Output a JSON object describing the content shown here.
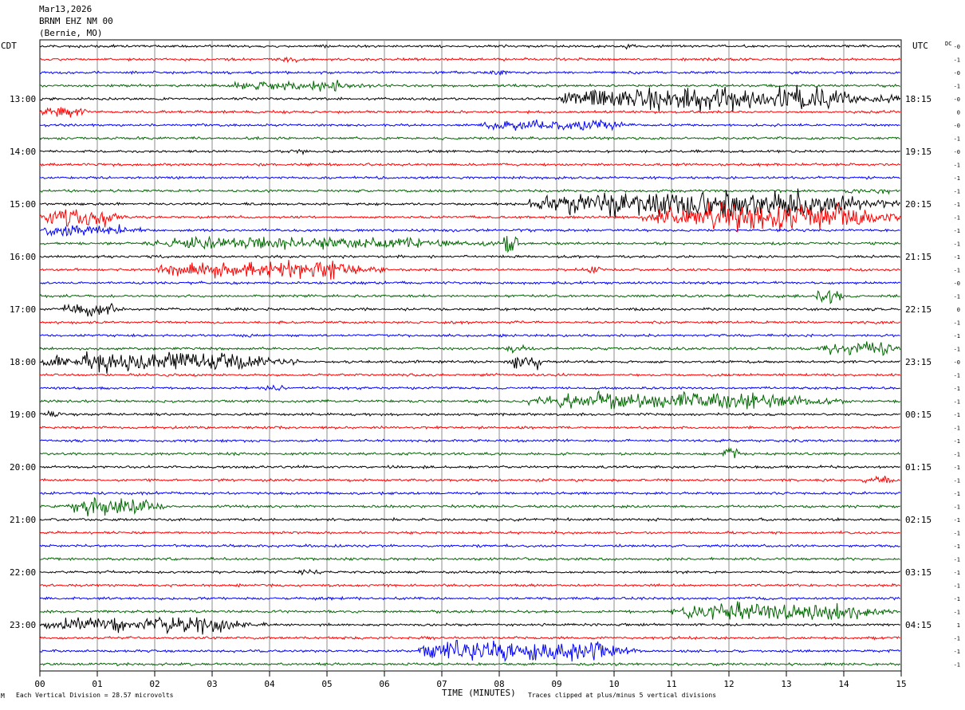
{
  "header": {
    "date": "Mar13,2026",
    "station": "BRNM EHZ NM 00",
    "location": "(Bernie, MO)"
  },
  "left_axis_title": "CDT",
  "right_axis_title": "UTC",
  "dc_label": "DC",
  "footer": {
    "corner_mark": "M",
    "scale_note": "Each Vertical Division =   28.57 microvolts",
    "clip_note": "Traces clipped at plus/minus 5 vertical divisions"
  },
  "chart_data": {
    "type": "line",
    "title": "",
    "xlabel": "TIME (MINUTES)",
    "ylabel": "",
    "x_range": [
      0,
      15
    ],
    "x_ticks": [
      "00",
      "01",
      "02",
      "03",
      "04",
      "05",
      "06",
      "07",
      "08",
      "09",
      "10",
      "11",
      "12",
      "13",
      "14",
      "15"
    ],
    "grid": true,
    "trace_colors": [
      "#000000",
      "#ff0000",
      "#0000ff",
      "#006600"
    ],
    "trace_count": 48,
    "cdt_labels": [
      "13:00",
      "14:00",
      "15:00",
      "16:00",
      "17:00",
      "18:00",
      "19:00",
      "20:00",
      "21:00",
      "22:00",
      "23:00"
    ],
    "utc_labels": [
      "18:15",
      "19:15",
      "20:15",
      "21:15",
      "22:15",
      "23:15",
      "00:15",
      "01:15",
      "02:15",
      "03:15",
      "04:15"
    ],
    "hour_label_start_trace": 4,
    "traces_per_hour": 4,
    "dc_offsets": [
      "-0",
      "-1",
      "-0",
      "-1",
      "-0",
      "0",
      "-0",
      "-1",
      "-0",
      "-1",
      "-1",
      "-1",
      "-1",
      "-1",
      "-1",
      "-1",
      "-1",
      "-1",
      "-0",
      "-1",
      "0",
      "-1",
      "-1",
      "-1",
      "-0",
      "-1",
      "-1",
      "-1",
      "-1",
      "-1",
      "-1",
      "-1",
      "-1",
      "-1",
      "-1",
      "-1",
      "-1",
      "-1",
      "-1",
      "-1",
      "-1",
      "-1",
      "-1",
      "-1",
      "1",
      "-1",
      "-1",
      "-1"
    ],
    "amplitude_baseline": 1.2,
    "events": [
      {
        "trace": 0,
        "start": 10.1,
        "end": 10.4,
        "amp": 3
      },
      {
        "trace": 1,
        "start": 4.2,
        "end": 4.6,
        "amp": 3
      },
      {
        "trace": 2,
        "start": 7.8,
        "end": 8.2,
        "amp": 2.5
      },
      {
        "trace": 3,
        "start": 3.2,
        "end": 5.8,
        "amp": 4
      },
      {
        "trace": 3,
        "start": 4.8,
        "end": 5.3,
        "amp": 6
      },
      {
        "trace": 4,
        "start": 9.0,
        "end": 15.0,
        "amp": 11
      },
      {
        "trace": 5,
        "start": 0.0,
        "end": 0.9,
        "amp": 5
      },
      {
        "trace": 6,
        "start": 7.6,
        "end": 10.5,
        "amp": 5
      },
      {
        "trace": 8,
        "start": 4.3,
        "end": 4.7,
        "amp": 3
      },
      {
        "trace": 11,
        "start": 14.0,
        "end": 15.0,
        "amp": 3
      },
      {
        "trace": 12,
        "start": 8.5,
        "end": 15.0,
        "amp": 13
      },
      {
        "trace": 13,
        "start": 0.0,
        "end": 1.5,
        "amp": 8
      },
      {
        "trace": 13,
        "start": 10.5,
        "end": 15.0,
        "amp": 12
      },
      {
        "trace": 14,
        "start": 0.0,
        "end": 1.8,
        "amp": 6
      },
      {
        "trace": 15,
        "start": 1.8,
        "end": 8.0,
        "amp": 6
      },
      {
        "trace": 15,
        "start": 8.05,
        "end": 8.35,
        "amp": 14
      },
      {
        "trace": 17,
        "start": 2.0,
        "end": 6.0,
        "amp": 8
      },
      {
        "trace": 17,
        "start": 9.5,
        "end": 9.8,
        "amp": 4
      },
      {
        "trace": 19,
        "start": 13.5,
        "end": 14.0,
        "amp": 7
      },
      {
        "trace": 20,
        "start": 0.4,
        "end": 1.5,
        "amp": 8
      },
      {
        "trace": 23,
        "start": 8.1,
        "end": 8.5,
        "amp": 4
      },
      {
        "trace": 23,
        "start": 13.5,
        "end": 15.0,
        "amp": 7
      },
      {
        "trace": 24,
        "start": 0.0,
        "end": 4.5,
        "amp": 9
      },
      {
        "trace": 24,
        "start": 8.2,
        "end": 8.8,
        "amp": 7
      },
      {
        "trace": 26,
        "start": 3.8,
        "end": 4.3,
        "amp": 3
      },
      {
        "trace": 27,
        "start": 8.5,
        "end": 14.0,
        "amp": 8
      },
      {
        "trace": 28,
        "start": 0.0,
        "end": 0.5,
        "amp": 3
      },
      {
        "trace": 31,
        "start": 11.9,
        "end": 12.2,
        "amp": 8
      },
      {
        "trace": 33,
        "start": 14.3,
        "end": 15.0,
        "amp": 4
      },
      {
        "trace": 35,
        "start": 0.5,
        "end": 2.2,
        "amp": 8
      },
      {
        "trace": 40,
        "start": 4.5,
        "end": 5.0,
        "amp": 3
      },
      {
        "trace": 43,
        "start": 11.0,
        "end": 15.0,
        "amp": 8
      },
      {
        "trace": 44,
        "start": 0.0,
        "end": 4.0,
        "amp": 8
      },
      {
        "trace": 46,
        "start": 6.5,
        "end": 10.5,
        "amp": 10
      }
    ]
  }
}
